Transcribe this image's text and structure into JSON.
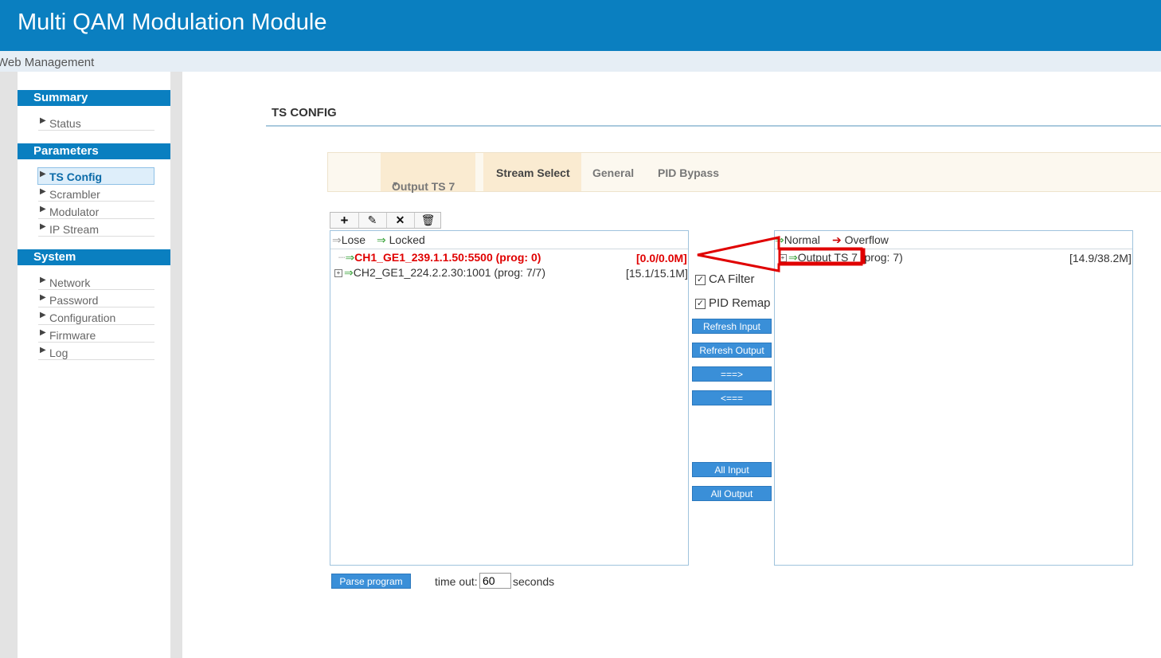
{
  "app": {
    "title": "Multi QAM Modulation Module",
    "subtitle": "Web Management"
  },
  "sidebar": {
    "sections": [
      {
        "title": "Summary",
        "items": [
          {
            "label": "Status"
          }
        ]
      },
      {
        "title": "Parameters",
        "items": [
          {
            "label": "TS Config",
            "active": true
          },
          {
            "label": "Scrambler"
          },
          {
            "label": "Modulator"
          },
          {
            "label": "IP Stream"
          }
        ]
      },
      {
        "title": "System",
        "items": [
          {
            "label": "Network"
          },
          {
            "label": "Password"
          },
          {
            "label": "Configuration"
          },
          {
            "label": "Firmware"
          },
          {
            "label": "Log"
          }
        ]
      }
    ]
  },
  "page": {
    "title": "TS CONFIG"
  },
  "tabs": {
    "dropdown": "Output TS 7",
    "stream_select": "Stream Select",
    "general": "General",
    "pid_bypass": "PID Bypass"
  },
  "toolbar": {
    "add": "add-icon",
    "edit": "pencil-icon",
    "remove": "x-icon",
    "delete": "trash-icon"
  },
  "input_panel": {
    "legend": {
      "lose": "Lose",
      "locked": "Locked"
    },
    "rows": [
      {
        "name": "CH1_GE1_239.1.1.50:5500 (prog: 0)",
        "rate": "[0.0/0.0M]",
        "status": "lose"
      },
      {
        "name": "CH2_GE1_224.2.2.30:1001 (prog: 7/7)",
        "rate": "[15.1/15.1M]",
        "status": "locked"
      }
    ]
  },
  "output_panel": {
    "legend": {
      "normal": "Normal",
      "overflow": "Overflow"
    },
    "rows": [
      {
        "name": "Output TS 7",
        "prog": "(prog: 7)",
        "rate": "[14.9/38.2M]"
      }
    ]
  },
  "middle": {
    "ca_filter": "CA Filter",
    "pid_remap": "PID Remap",
    "refresh_input": "Refresh Input",
    "refresh_output": "Refresh Output",
    "move_right": "===>",
    "move_left": "<===",
    "all_input": "All Input",
    "all_output": "All Output"
  },
  "footer": {
    "parse": "Parse program",
    "timeout_label": "time out:",
    "timeout_value": "60",
    "seconds": "seconds"
  },
  "colors": {
    "brand": "#0a7fc0",
    "button": "#3a8fd8",
    "lose_text": "#e00000",
    "annotation": "#e00000"
  }
}
